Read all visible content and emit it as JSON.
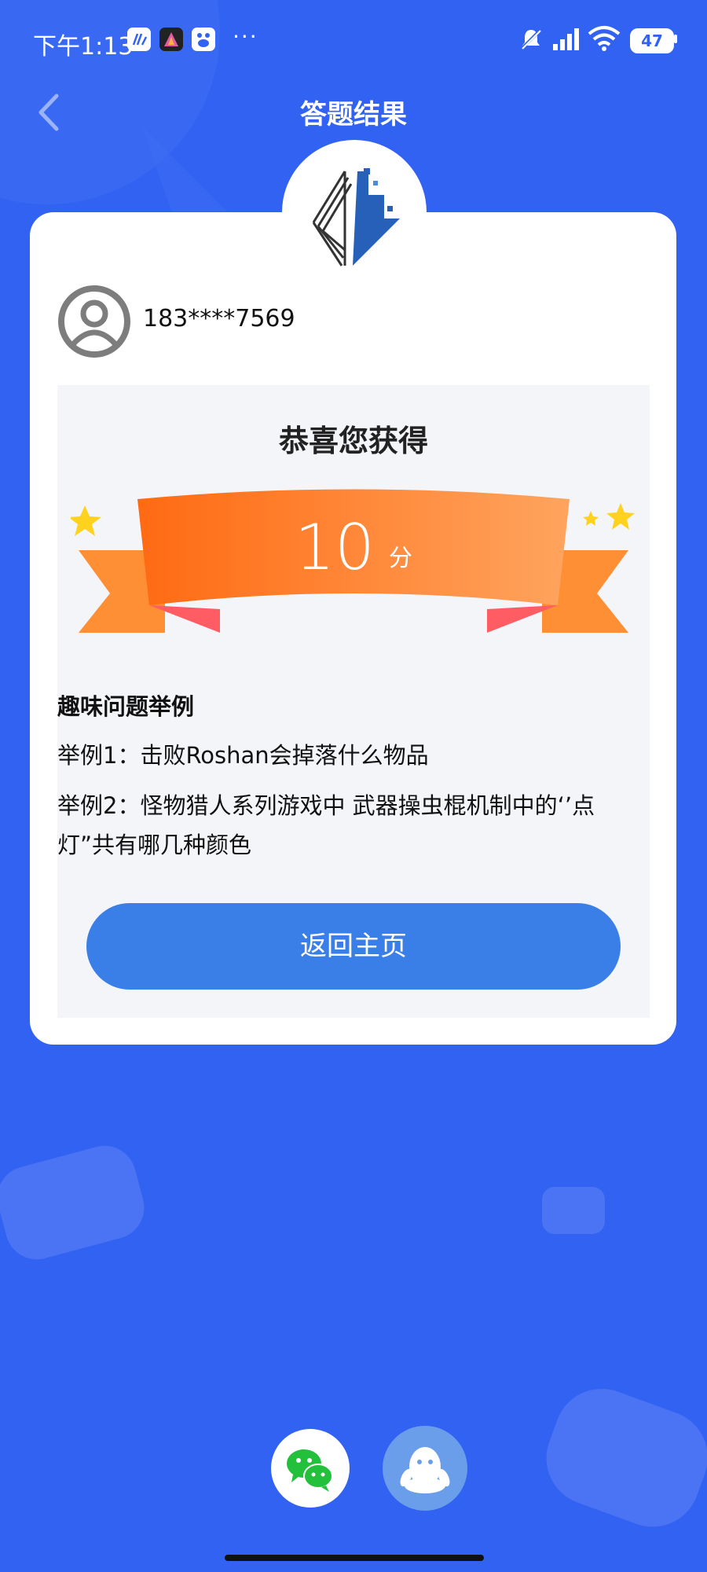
{
  "status_bar": {
    "time": "下午1:13",
    "more": "···",
    "battery": "47",
    "icons": [
      "app-icon",
      "prism-app-icon",
      "baidu-icon",
      "mute-icon",
      "signal-icon",
      "wifi-icon",
      "battery-icon"
    ]
  },
  "header": {
    "title": "答题结果",
    "back_icon": "chevron-left-icon"
  },
  "user": {
    "phone": "183****7569",
    "avatar_icon": "user-avatar-icon"
  },
  "result": {
    "congrats": "恭喜您获得",
    "score": "10",
    "unit": "分"
  },
  "examples": {
    "title": "趣味问题举例",
    "items": [
      "举例1：击败Roshan会掉落什么物品",
      "举例2：怪物猎人系列游戏中 武器操虫棍机制中的‘’点灯”共有哪几种颜色"
    ]
  },
  "buttons": {
    "home": "返回主页"
  },
  "share": {
    "wechat_icon": "wechat-icon",
    "qq_icon": "qq-icon"
  },
  "colors": {
    "background": "#3262F2",
    "button": "#3A7FE8",
    "ribbon_orange": "#FF7A22",
    "star": "#FFD21F"
  }
}
